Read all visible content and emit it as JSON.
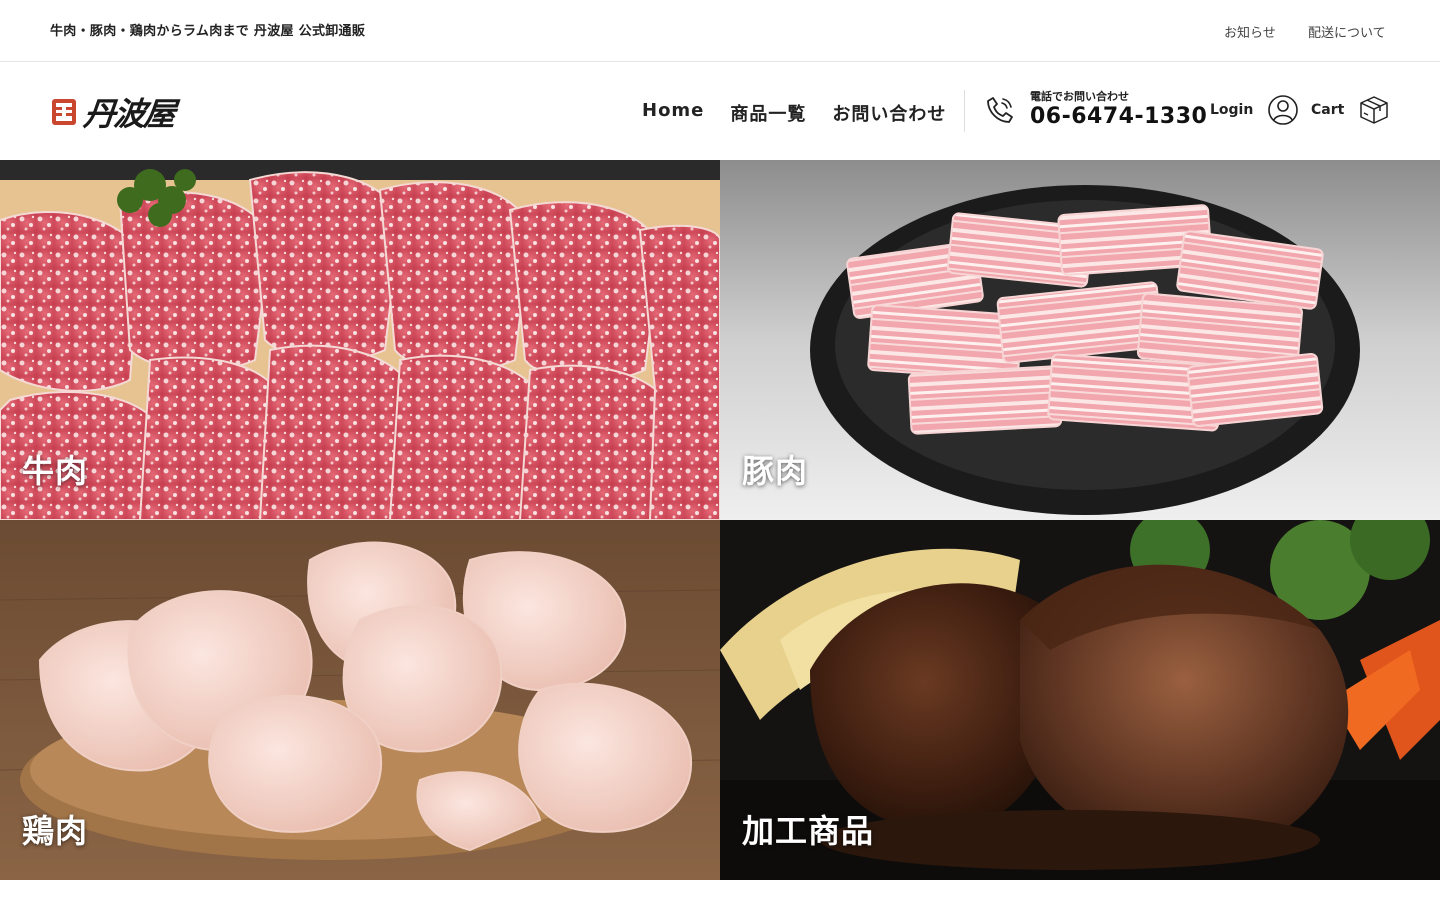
{
  "topbar": {
    "tagline": "牛肉・豚肉・鶏肉からラム肉まで 丹波屋 公式卸通販",
    "links": [
      "お知らせ",
      "配送について"
    ]
  },
  "header": {
    "logo_text": "丹波屋",
    "nav": [
      "Home",
      "商品一覧",
      "お問い合わせ"
    ],
    "phone_label": "電話でお問い合わせ",
    "phone_number": "06-6474-1330",
    "login_label": "Login",
    "cart_label": "Cart",
    "icons": [
      "phone-icon",
      "user-icon",
      "cart-box-icon"
    ]
  },
  "categories": [
    {
      "label": "牛肉",
      "image": "marbled beef slices"
    },
    {
      "label": "豚肉",
      "image": "pork belly slices on black plate"
    },
    {
      "label": "鶏肉",
      "image": "raw chicken on wooden board"
    },
    {
      "label": "加工商品",
      "image": "hamburg steak with sauce"
    }
  ],
  "colors": {
    "logo_accent": "#c8472e",
    "text": "#222222",
    "border": "#e6e6e6"
  }
}
